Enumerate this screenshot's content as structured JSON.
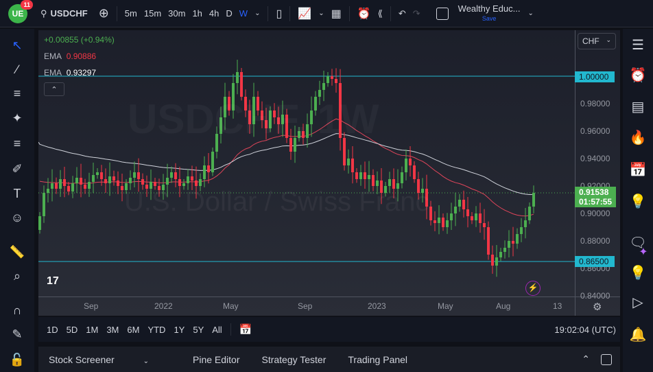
{
  "topbar": {
    "badge": "11",
    "symbol": "USDCHF",
    "intervals": [
      "5m",
      "15m",
      "30m",
      "1h",
      "4h",
      "D",
      "W"
    ],
    "active_interval": "W",
    "layout_name": "Wealthy Educ...",
    "save_label": "Save"
  },
  "legend": {
    "change": "+0.00855 (+0.94%)",
    "ema1_label": "EMA",
    "ema1_value": "0.90886",
    "ema2_label": "EMA",
    "ema2_value": "0.93297"
  },
  "watermark": {
    "title": "USDCHF, 1W",
    "subtitle": "U.S. Dollar / Swiss Franc"
  },
  "currency": "CHF",
  "price_axis": [
    "0.98000",
    "0.96000",
    "0.94000",
    "0.92000",
    "0.90000",
    "0.88000",
    "0.86000",
    "0.84000"
  ],
  "price_tags": {
    "upper_line": "1.00000",
    "lower_line": "0.86500",
    "last_price": "0.91538",
    "countdown": "01:57:55"
  },
  "time_axis": [
    "Sep",
    "2022",
    "May",
    "Sep",
    "2023",
    "May",
    "Aug",
    "13"
  ],
  "range_buttons": [
    "1D",
    "5D",
    "1M",
    "3M",
    "6M",
    "YTD",
    "1Y",
    "5Y",
    "All"
  ],
  "clock": "19:02:04 (UTC)",
  "bottom_tabs": [
    "Stock Screener",
    "Pine Editor",
    "Strategy Tester",
    "Trading Panel"
  ],
  "colors": {
    "up": "#4caf50",
    "down": "#f23645",
    "ema_fast": "#e0455a",
    "ema_slow": "#d1d4dc",
    "hline": "#22b8cf",
    "accent": "#2962ff"
  },
  "chart_data": {
    "type": "candlestick",
    "ylim": [
      0.84,
      1.005
    ],
    "hlines": [
      1.0,
      0.865
    ],
    "ema_seed": [
      0.925,
      0.952
    ],
    "ema_periods": [
      50,
      200
    ],
    "closes": [
      0.898,
      0.915,
      0.918,
      0.922,
      0.918,
      0.925,
      0.92,
      0.916,
      0.922,
      0.926,
      0.921,
      0.918,
      0.923,
      0.928,
      0.93,
      0.925,
      0.922,
      0.927,
      0.924,
      0.92,
      0.917,
      0.922,
      0.926,
      0.93,
      0.925,
      0.921,
      0.918,
      0.923,
      0.92,
      0.917,
      0.921,
      0.926,
      0.93,
      0.925,
      0.92,
      0.922,
      0.927,
      0.924,
      0.92,
      0.925,
      0.935,
      0.93,
      0.945,
      0.958,
      0.97,
      0.985,
      0.975,
      0.995,
      1.003,
      0.985,
      0.975,
      0.965,
      0.985,
      0.975,
      0.968,
      0.962,
      0.975,
      0.97,
      0.965,
      0.972,
      0.955,
      0.945,
      0.955,
      0.96,
      0.955,
      0.965,
      0.975,
      0.985,
      0.99,
      0.995,
      1.0,
      0.998,
      0.995,
      0.955,
      0.935,
      0.94,
      0.93,
      0.925,
      0.93,
      0.925,
      0.928,
      0.92,
      0.924,
      0.915,
      0.92,
      0.925,
      0.918,
      0.922,
      0.93,
      0.94,
      0.935,
      0.925,
      0.915,
      0.918,
      0.905,
      0.895,
      0.893,
      0.897,
      0.89,
      0.895,
      0.9,
      0.905,
      0.91,
      0.903,
      0.898,
      0.895,
      0.9,
      0.893,
      0.89,
      0.87,
      0.862,
      0.868,
      0.872,
      0.875,
      0.88,
      0.878,
      0.885,
      0.89,
      0.895,
      0.905,
      0.915
    ]
  }
}
